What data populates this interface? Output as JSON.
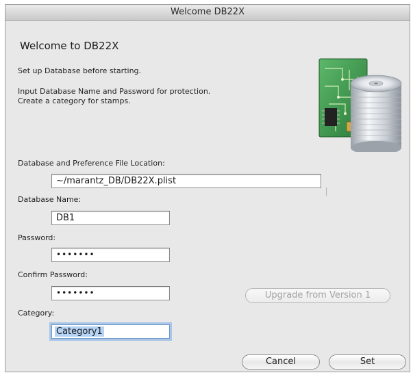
{
  "window": {
    "title": "Welcome DB22X"
  },
  "intro": {
    "heading": "Welcome to DB22X",
    "line1": "Set up Database before starting.",
    "line2": "Input Database Name and Password for protection.",
    "line3": "Create a category for stamps."
  },
  "form": {
    "location_label": "Database and Preference File Location:",
    "location_value": "~/marantz_DB/DB22X.plist",
    "db_name_label": "Database Name:",
    "db_name_value": "DB1",
    "password_label": "Password:",
    "password_value": "•••••••",
    "confirm_label": "Confirm Password:",
    "confirm_value": "•••••••",
    "category_label": "Category:",
    "category_value": "Category1"
  },
  "buttons": {
    "upgrade": "Upgrade from Version 1",
    "cancel": "Cancel",
    "set": "Set"
  },
  "icons": {
    "app_illustration": "database-disk-stack-icon"
  },
  "colors": {
    "window_bg": "#e8e8e8",
    "focus_ring": "#a9c6e8",
    "selection": "#b5d3f5",
    "circuit_board": "#3a8d4a"
  }
}
